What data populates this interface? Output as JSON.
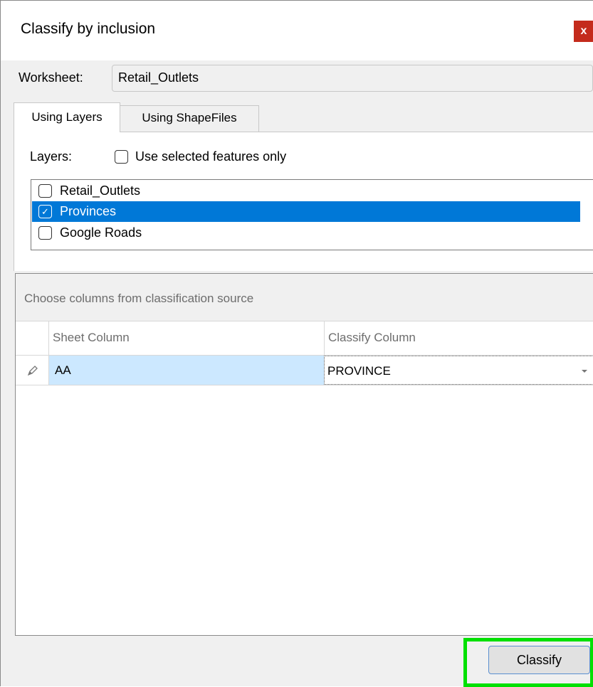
{
  "window": {
    "title": "Classify by inclusion",
    "close_label": "x"
  },
  "worksheet": {
    "label": "Worksheet:",
    "value": "Retail_Outlets"
  },
  "tabs": [
    {
      "label": "Using Layers",
      "active": true
    },
    {
      "label": "Using ShapeFiles",
      "active": false
    }
  ],
  "layers_panel": {
    "label": "Layers:",
    "selected_only_label": "Use selected features only",
    "selected_only_checked": false,
    "items": [
      {
        "label": "Retail_Outlets",
        "checked": false,
        "selected": false
      },
      {
        "label": "Provinces",
        "checked": true,
        "selected": true
      },
      {
        "label": "Google Roads",
        "checked": false,
        "selected": false
      }
    ]
  },
  "grid": {
    "caption": "Choose columns from classification source",
    "columns": [
      "Sheet Column",
      "Classify Column"
    ],
    "rows": [
      {
        "sheet_column": "AA",
        "classify_column": "PROVINCE"
      }
    ]
  },
  "actions": {
    "classify_label": "Classify"
  },
  "colors": {
    "selection": "#0078d7",
    "close_button": "#c42b1c",
    "highlight": "#00e000",
    "cell_selected": "#cce8ff"
  },
  "icons": {
    "close": "close-icon",
    "checkmark": "checkmark-icon",
    "row_edit": "pencil-icon",
    "dropdown": "chevron-down-icon"
  }
}
